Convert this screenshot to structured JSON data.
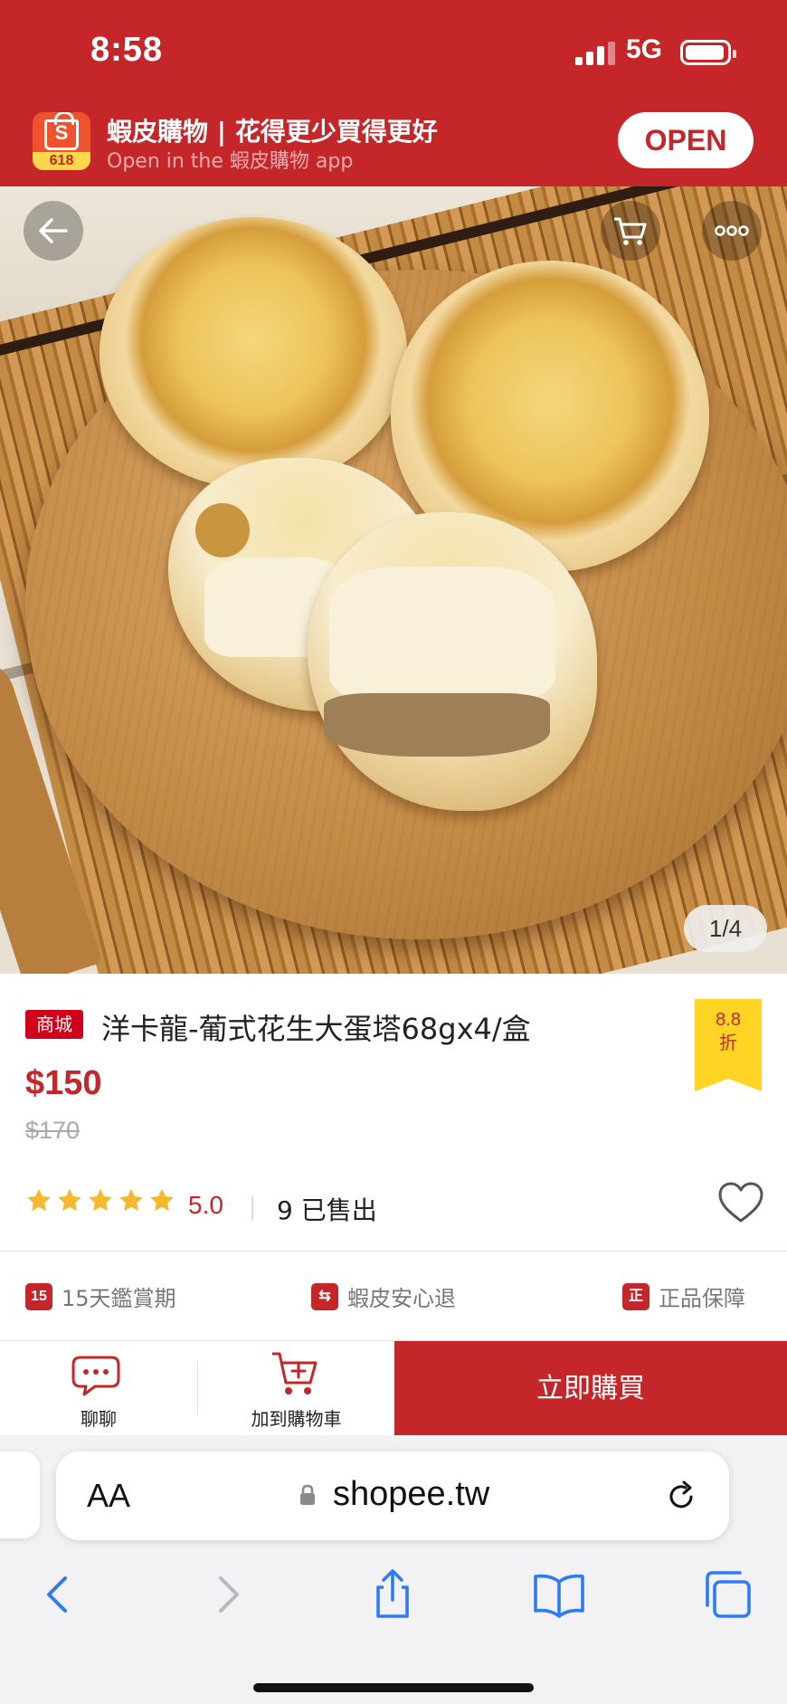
{
  "status_bar": {
    "time": "8:58",
    "network": "5G"
  },
  "app_banner": {
    "title": "蝦皮購物 | 花得更少買得更好",
    "subtitle": "Open in the 蝦皮購物 app",
    "open_label": "OPEN",
    "logo_letter": "S",
    "logo_badge": "618"
  },
  "gallery": {
    "counter": "1/4",
    "back_icon": "arrow-left-icon",
    "cart_icon": "cart-icon",
    "more_icon": "more-dots-icon"
  },
  "product": {
    "mall_tag": "商城",
    "name": "洋卡龍-葡式花生大蛋塔68gx4/盒",
    "discount_value": "8.8",
    "discount_unit": "折",
    "price": "$150",
    "original_price": "$170",
    "rating": "5.0",
    "rating_value": 5,
    "rating_max": 5,
    "sold": "9 已售出"
  },
  "guarantees": [
    {
      "label": "15天鑑賞期",
      "icon": "15",
      "icon_name": "fifteen-day-icon"
    },
    {
      "label": "蝦皮安心退",
      "icon": "⇆",
      "icon_name": "return-truck-icon"
    },
    {
      "label": "正品保障",
      "icon": "正",
      "icon_name": "authentic-icon"
    }
  ],
  "actions": {
    "chat_label": "聊聊",
    "add_cart_label": "加到購物車",
    "buy_label": "立即購買"
  },
  "browser": {
    "aa_label": "AA",
    "url": "shopee.tw"
  },
  "colors": {
    "brand_red": "#c4262a",
    "discount_yellow": "#ffd424",
    "star_gold": "#f5b82e",
    "safari_blue": "#2f7af5"
  }
}
